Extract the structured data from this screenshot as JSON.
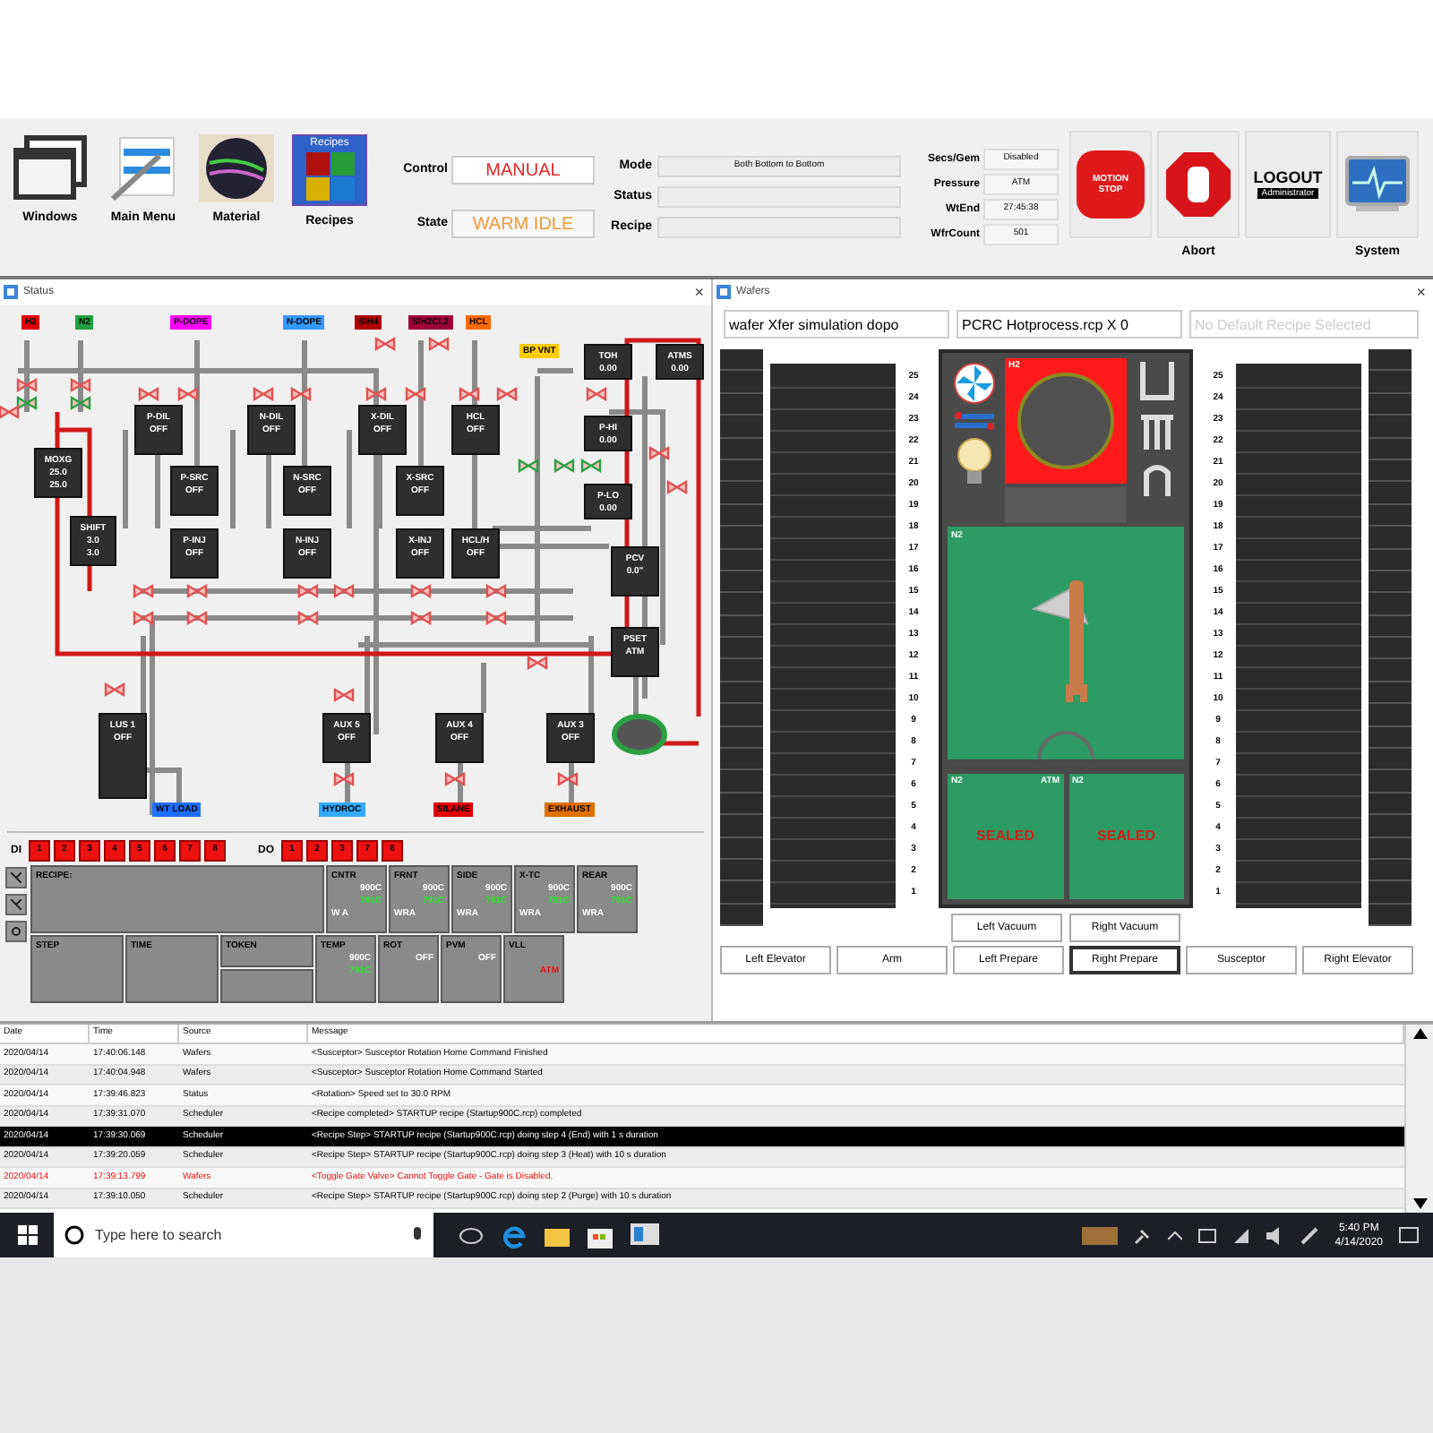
{
  "toolbar": {
    "buttons": [
      {
        "kind": "windows",
        "label": "Windows"
      },
      {
        "kind": "menu",
        "label": "Main Menu"
      },
      {
        "kind": "material",
        "label": "Material"
      },
      {
        "kind": "recipes",
        "label": "Recipes",
        "icon_text": "Recipes"
      }
    ],
    "control": {
      "label": "Control",
      "value": "MANUAL"
    },
    "state": {
      "label": "State",
      "value": "WARM IDLE"
    },
    "info": [
      {
        "label": "Mode",
        "value": "Both Bottom to Bottom"
      },
      {
        "label": "Status"
      },
      {
        "label": "Recipe"
      }
    ],
    "stats": [
      {
        "label": "Secs/Gem",
        "value": "Disabled"
      },
      {
        "label": "Pressure",
        "value": "ATM"
      },
      {
        "label": "WtEnd",
        "value": "27:45:38"
      },
      {
        "label": "WfrCount",
        "value": "501"
      }
    ],
    "actions": [
      {
        "kind": "motion_stop",
        "sign": [
          "MOTION",
          "STOP"
        ]
      },
      {
        "kind": "abort",
        "label": "Abort"
      },
      {
        "kind": "logout",
        "title": "LOGOUT",
        "user": "Administrator"
      },
      {
        "kind": "system",
        "label": "System"
      }
    ]
  },
  "status_window": {
    "title": "Status",
    "close": "×",
    "tags": [
      {
        "label": "H2",
        "color": "#e00000"
      },
      {
        "label": "N2",
        "color": "#20a040"
      },
      {
        "label": "P-DOPE",
        "color": "#ff00ff"
      },
      {
        "label": "N-DOPE",
        "color": "#3399ff"
      },
      {
        "label": "SIH4",
        "color": "#b00000"
      },
      {
        "label": "SIH2CL2",
        "color": "#a0003a"
      },
      {
        "label": "HCL",
        "color": "#ff6a00"
      },
      {
        "label": "BP VNT",
        "color": "#ffcc00"
      },
      {
        "label": "WT LOAD",
        "color": "#1e6fff"
      },
      {
        "label": "HYDROC",
        "color": "#33aaff"
      },
      {
        "label": "SILANE",
        "color": "#e00000"
      },
      {
        "label": "EXHAUST",
        "color": "#e07000"
      }
    ],
    "nodes": [
      {
        "label": "MOXG",
        "lines": [
          "25.0",
          "25.0"
        ]
      },
      {
        "label": "SHIFT",
        "lines": [
          "3.0",
          "3.0"
        ]
      },
      {
        "label": "P-DIL",
        "lines": [
          "OFF"
        ]
      },
      {
        "label": "P-SRC",
        "lines": [
          "OFF"
        ]
      },
      {
        "label": "P-INJ",
        "lines": [
          "OFF"
        ]
      },
      {
        "label": "N-DIL",
        "lines": [
          "OFF"
        ]
      },
      {
        "label": "N-SRC",
        "lines": [
          "OFF"
        ]
      },
      {
        "label": "N-INJ",
        "lines": [
          "OFF"
        ]
      },
      {
        "label": "X-DIL",
        "lines": [
          "OFF"
        ]
      },
      {
        "label": "X-SRC",
        "lines": [
          "OFF"
        ]
      },
      {
        "label": "X-INJ",
        "lines": [
          "OFF"
        ]
      },
      {
        "label": "HCL",
        "lines": [
          "OFF"
        ]
      },
      {
        "label": "HCL/H",
        "lines": [
          "OFF"
        ]
      },
      {
        "label": "TOH",
        "lines": [
          "0.00"
        ]
      },
      {
        "label": "ATMS",
        "lines": [
          "0.00"
        ]
      },
      {
        "label": "P-HI",
        "lines": [
          "0.00"
        ]
      },
      {
        "label": "P-LO",
        "lines": [
          "0.00"
        ]
      },
      {
        "label": "PCV",
        "lines": [
          "0.0\""
        ]
      },
      {
        "label": "PSET",
        "lines": [
          "ATM"
        ]
      },
      {
        "label": "LUS 1",
        "lines": [
          "OFF"
        ]
      },
      {
        "label": "AUX 5",
        "lines": [
          "OFF"
        ]
      },
      {
        "label": "AUX 4",
        "lines": [
          "OFF"
        ]
      },
      {
        "label": "AUX 3",
        "lines": [
          "OFF"
        ]
      }
    ],
    "di": {
      "label": "DI",
      "items": [
        "1",
        "2",
        "3",
        "4",
        "5",
        "6",
        "7",
        "8"
      ]
    },
    "do": {
      "label": "DO",
      "items": [
        "1",
        "2",
        "3",
        "7",
        "8"
      ]
    },
    "recipe_label": "RECIPE:",
    "zones": [
      {
        "label": "CNTR",
        "set": "900C",
        "actual": "791C",
        "flags": "W A"
      },
      {
        "label": "FRNT",
        "set": "900C",
        "actual": "791C",
        "flags": "WRA"
      },
      {
        "label": "SIDE",
        "set": "900C",
        "actual": "791C",
        "flags": "WRA"
      },
      {
        "label": "X-TC",
        "set": "900C",
        "actual": "791C",
        "flags": "WRA"
      },
      {
        "label": "REAR",
        "set": "900C",
        "actual": "791C",
        "flags": "WRA"
      }
    ],
    "steps": [
      {
        "label": "STEP"
      },
      {
        "label": "TIME"
      },
      {
        "label": "TOKEN"
      }
    ],
    "readings": [
      {
        "kind": "temp",
        "label": "TEMP",
        "set": "900C",
        "actual": "791C"
      },
      {
        "kind": "plain",
        "label": "ROT",
        "value": "OFF"
      },
      {
        "kind": "plain",
        "label": "PVM",
        "value": "OFF"
      },
      {
        "kind": "alarm",
        "label": "VLL",
        "value": "ATM"
      }
    ]
  },
  "wafers_window": {
    "title": "Wafers",
    "close": "×",
    "fields": [
      {
        "value": "wafer Xfer simulation dopo"
      },
      {
        "value": "PCRC Hotprocess.rcp X 0"
      },
      {
        "placeholder": "No Default Recipe Selected"
      }
    ],
    "left_slots": [
      "25",
      "24",
      "23",
      "22",
      "21",
      "20",
      "19",
      "18",
      "17",
      "16",
      "15",
      "14",
      "13",
      "12",
      "11",
      "10",
      "9",
      "8",
      "7",
      "6",
      "5",
      "4",
      "3",
      "2",
      "1"
    ],
    "right_slots": [
      "25",
      "24",
      "23",
      "22",
      "21",
      "20",
      "19",
      "18",
      "17",
      "16",
      "15",
      "14",
      "13",
      "12",
      "11",
      "10",
      "9",
      "8",
      "7",
      "6",
      "5",
      "4",
      "3",
      "2",
      "1"
    ],
    "chamber": {
      "process_gas": "H2",
      "transfer_gas": "N2",
      "left_lock": {
        "gas": "N2",
        "pressure": "ATM",
        "state": "SEALED"
      },
      "right_lock": {
        "gas": "N2",
        "state": "SEALED"
      }
    },
    "vacuum_buttons": [
      {
        "label": "Left Vacuum",
        "selected": false
      },
      {
        "label": "Right Vacuum",
        "selected": false
      }
    ],
    "buttons": [
      {
        "label": "Left Elevator",
        "selected": false
      },
      {
        "label": "Arm",
        "selected": false
      },
      {
        "label": "Left Prepare",
        "selected": false
      },
      {
        "label": "Right Prepare",
        "selected": true
      },
      {
        "label": "Susceptor",
        "selected": false
      },
      {
        "label": "Right Elevator",
        "selected": false
      }
    ]
  },
  "log": {
    "columns": [
      "Date",
      "Time",
      "Source",
      "Message"
    ],
    "rows": [
      {
        "date": "2020/04/14",
        "time": "17:40:06.148",
        "source": "Wafers",
        "message": "<Susceptor> Susceptor Rotation Home Command Finished",
        "kind": "info",
        "selected": false
      },
      {
        "date": "2020/04/14",
        "time": "17:40:04.948",
        "source": "Wafers",
        "message": "<Susceptor> Susceptor Rotation Home Command Started",
        "kind": "info",
        "selected": false
      },
      {
        "date": "2020/04/14",
        "time": "17:39:46.823",
        "source": "Status",
        "message": "<Rotation> Speed set to 30.0 RPM",
        "kind": "info",
        "selected": false
      },
      {
        "date": "2020/04/14",
        "time": "17:39:31.070",
        "source": "Scheduler",
        "message": "<Recipe completed> STARTUP recipe (Startup900C.rcp) completed",
        "kind": "info",
        "selected": false
      },
      {
        "date": "2020/04/14",
        "time": "17:39:30.069",
        "source": "Scheduler",
        "message": "<Recipe Step> STARTUP recipe (Startup900C.rcp) doing step 4 (End) with 1 s duration",
        "kind": "info",
        "selected": true
      },
      {
        "date": "2020/04/14",
        "time": "17:39:20.059",
        "source": "Scheduler",
        "message": "<Recipe Step> STARTUP recipe (Startup900C.rcp) doing step 3 (Heat) with 10 s duration",
        "kind": "info",
        "selected": false
      },
      {
        "date": "2020/04/14",
        "time": "17:39:13.799",
        "source": "Wafers",
        "message": "<Toggle Gate Valve> Cannot Toggle Gate - Gate is Disabled.",
        "kind": "error",
        "selected": false
      },
      {
        "date": "2020/04/14",
        "time": "17:39:10.050",
        "source": "Scheduler",
        "message": "<Recipe Step> STARTUP recipe (Startup900C.rcp) doing step 2 (Purge) with 10 s duration",
        "kind": "info",
        "selected": false
      }
    ]
  },
  "taskbar": {
    "search_placeholder": "Type here to search",
    "time": "5:40 PM",
    "date": "4/14/2020"
  }
}
